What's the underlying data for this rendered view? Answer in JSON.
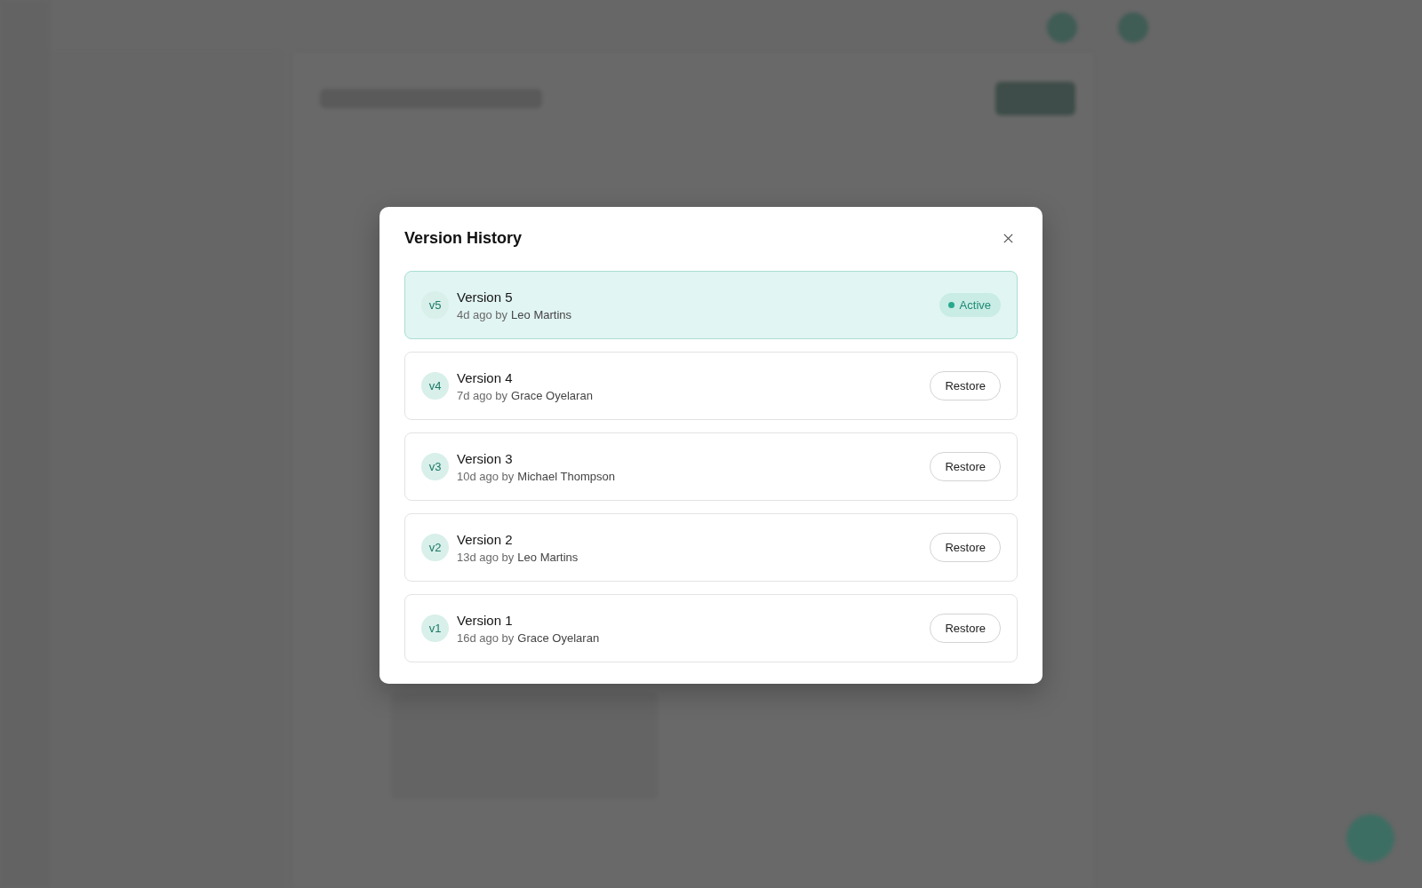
{
  "dialog": {
    "title": "Version History",
    "versions": [
      {
        "badge": "v5",
        "title": "Version 5",
        "age": "4d ago by",
        "author": "Leo Martins",
        "active": true,
        "status": "Active"
      },
      {
        "badge": "v4",
        "title": "Version 4",
        "age": "7d ago by",
        "author": "Grace Oyelaran",
        "active": false,
        "action": "Restore"
      },
      {
        "badge": "v3",
        "title": "Version 3",
        "age": "10d ago by",
        "author": "Michael Thompson",
        "active": false,
        "action": "Restore"
      },
      {
        "badge": "v2",
        "title": "Version 2",
        "age": "13d ago by",
        "author": "Leo Martins",
        "active": false,
        "action": "Restore"
      },
      {
        "badge": "v1",
        "title": "Version 1",
        "age": "16d ago by",
        "author": "Grace Oyelaran",
        "active": false,
        "action": "Restore"
      }
    ]
  }
}
